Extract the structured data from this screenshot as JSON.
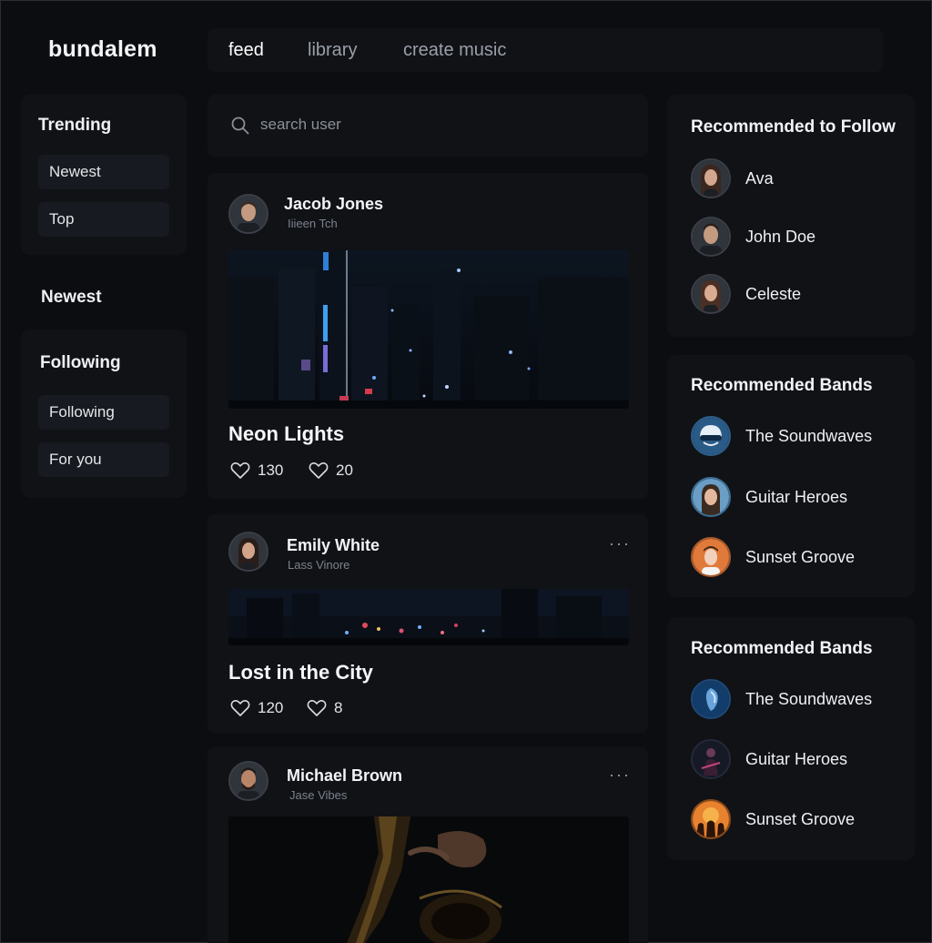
{
  "app": {
    "logo": "bundalem"
  },
  "nav": {
    "tabs": [
      {
        "label": "feed",
        "active": true
      },
      {
        "label": "library",
        "active": false
      },
      {
        "label": "create music",
        "active": false
      }
    ]
  },
  "sidebar": {
    "trending": {
      "title": "Trending",
      "items": [
        "Newest",
        "Top"
      ]
    },
    "newest": {
      "title": "Newest"
    },
    "following": {
      "title": "Following",
      "items": [
        "Following",
        "For you"
      ]
    }
  },
  "search": {
    "placeholder": "search user"
  },
  "posts": [
    {
      "author": "Jacob Jones",
      "subtitle": "Iiieen Tch",
      "title": "Neon Lights",
      "likes": "130",
      "comments": "20"
    },
    {
      "author": "Emily White",
      "subtitle": "Lass Vinore",
      "title": "Lost in the City",
      "likes": "120",
      "comments": "8"
    },
    {
      "author": "Michael Brown",
      "subtitle": "Jase Vibes"
    }
  ],
  "recommended_follow": {
    "title": "Recommended to Follow",
    "users": [
      "Ava",
      "John Doe",
      "Celeste"
    ]
  },
  "recommended_bands_1": {
    "title": "Recommended Bands",
    "bands": [
      "The Soundwaves",
      "Guitar Heroes",
      "Sunset Groove"
    ]
  },
  "recommended_bands_2": {
    "title": "Recommended Bands",
    "bands": [
      "The Soundwaves",
      "Guitar Heroes",
      "Sunset Groove"
    ]
  },
  "icons": {
    "search": "search-icon",
    "heart": "heart-icon",
    "more": "more-horizontal-icon"
  },
  "colors": {
    "background": "#0b0d11",
    "panel": "#101216",
    "pill": "#171a20",
    "text": "#eef0f4",
    "muted": "#8a9099"
  }
}
